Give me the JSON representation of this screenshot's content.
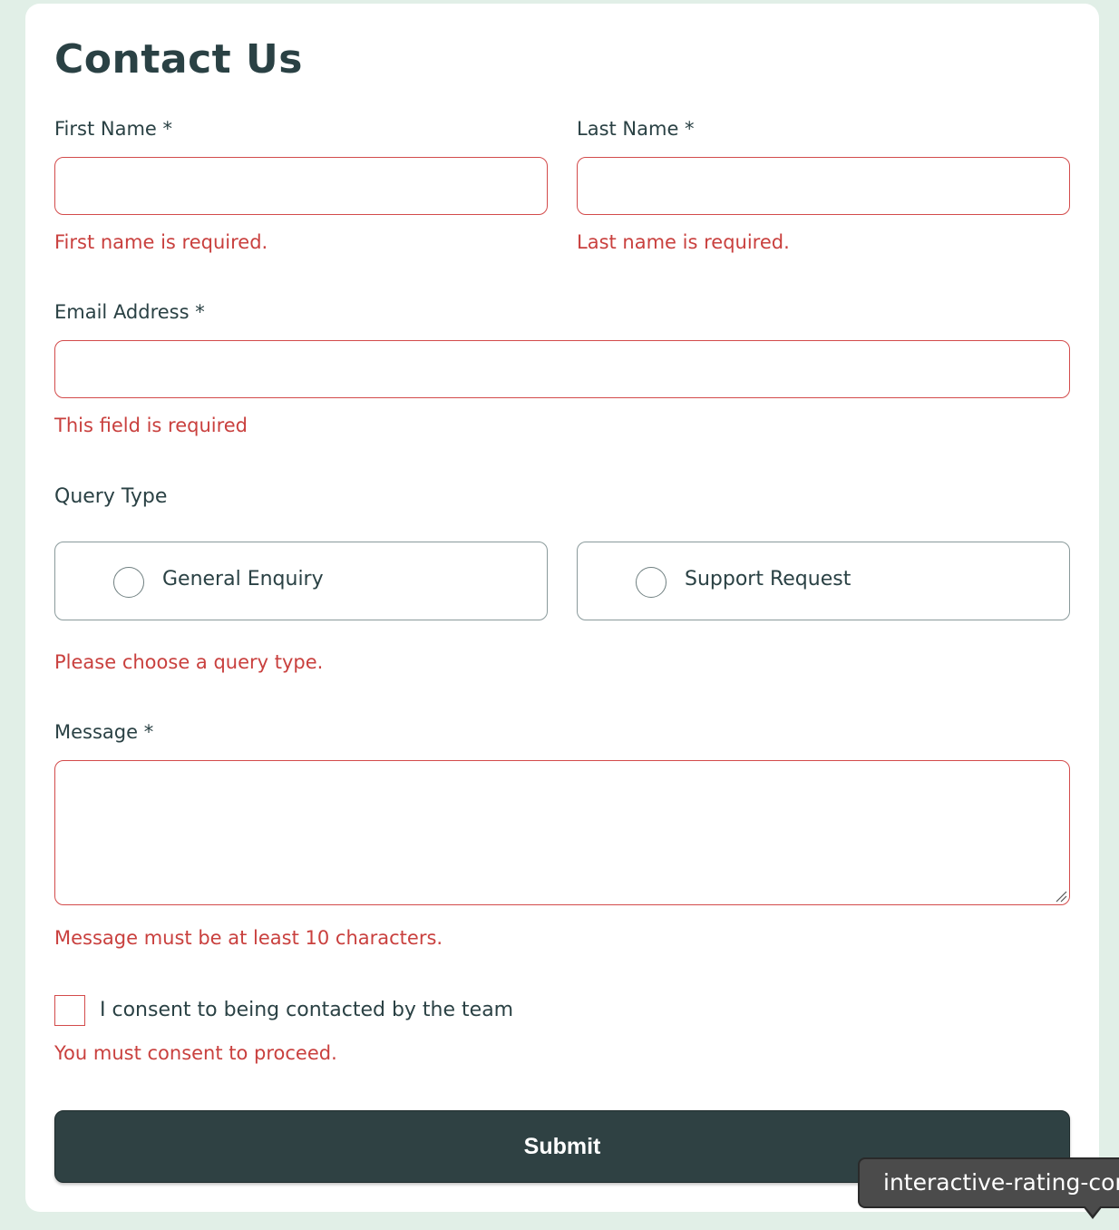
{
  "form": {
    "title": "Contact Us",
    "first_name": {
      "label": "First Name *",
      "value": "",
      "error": "First name is required."
    },
    "last_name": {
      "label": "Last Name *",
      "value": "",
      "error": "Last name is required."
    },
    "email": {
      "label": "Email Address *",
      "value": "",
      "error": "This field is required"
    },
    "query_type": {
      "label": "Query Type",
      "options": [
        {
          "label": "General Enquiry",
          "selected": false
        },
        {
          "label": "Support Request",
          "selected": false
        }
      ],
      "error": "Please choose a query type."
    },
    "message": {
      "label": "Message *",
      "value": "",
      "error": "Message must be at least 10 characters."
    },
    "consent": {
      "label": "I consent to being contacted by the team",
      "checked": false,
      "error": "You must consent to proceed."
    },
    "submit_label": "Submit"
  },
  "tooltip": {
    "text": "interactive-rating-component"
  },
  "colors": {
    "page_background": "#e1efe7",
    "card_background": "#ffffff",
    "text_primary": "#2a4144",
    "error": "#c9403e",
    "error_border": "#d34b4b",
    "button_background": "#2f4143",
    "tooltip_background": "#4b4b4b"
  }
}
